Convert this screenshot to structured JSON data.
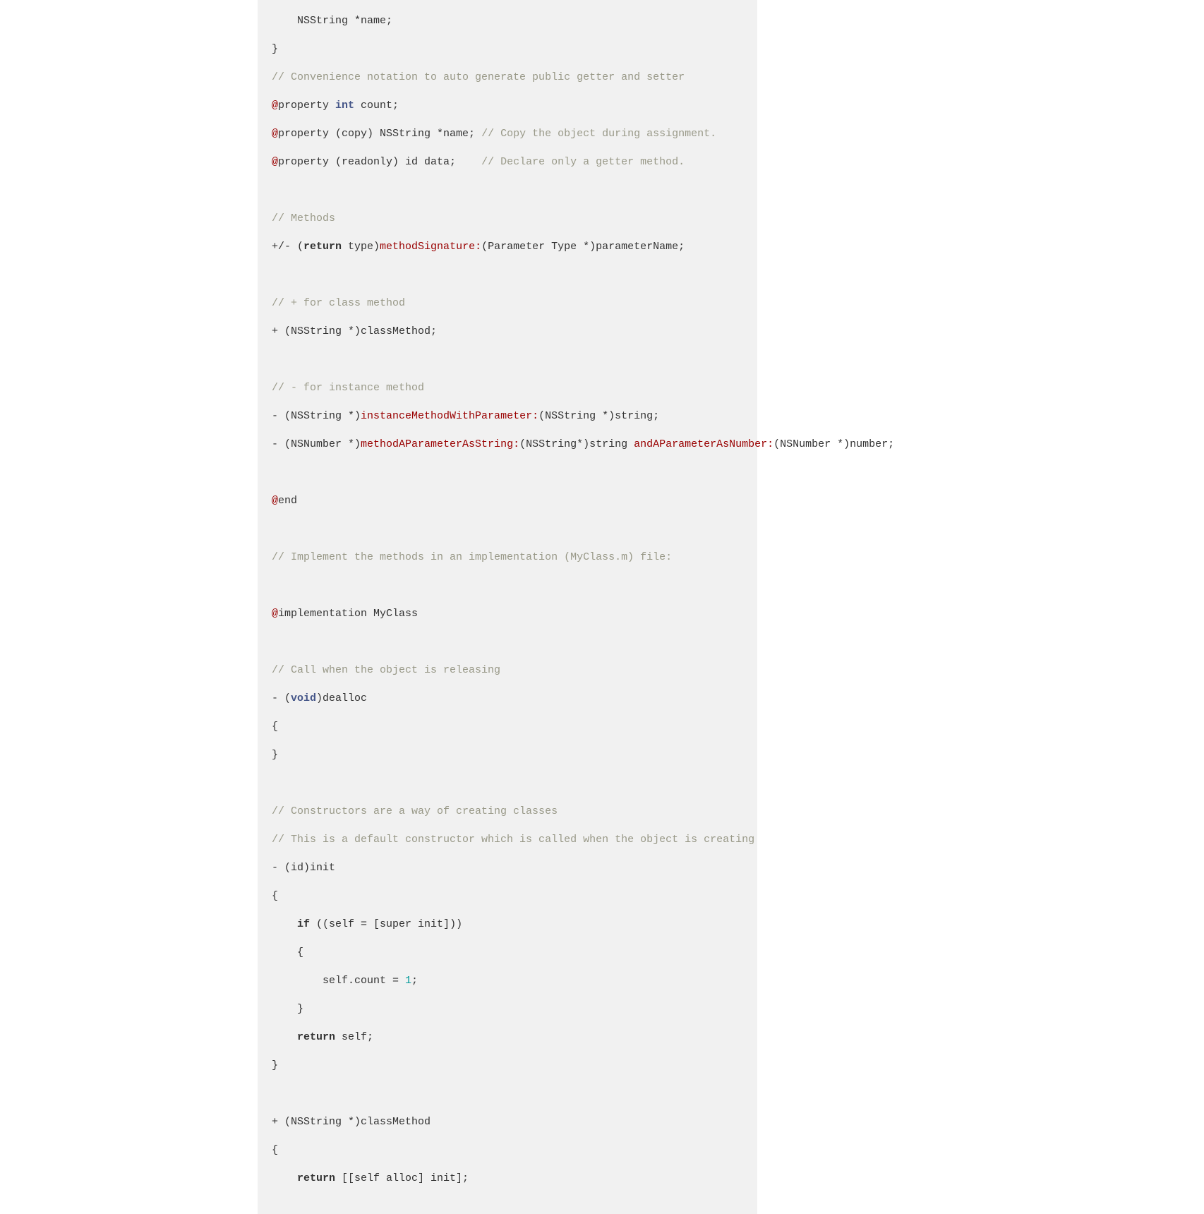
{
  "lines": {
    "l0": "    NSString *name;",
    "l1": "}",
    "c2": "// Convenience notation to auto generate public getter and setter",
    "l3a": "property ",
    "l3b": "int",
    "l3c": " count;",
    "l4a": "property (copy) NSString *name; ",
    "l4b": "// Copy the object during assignment.",
    "l5a": "property (readonly) id data;    ",
    "l5b": "// Declare only a getter method.",
    "c7": "// Methods",
    "l8a": "+/- (",
    "l8b": "return",
    "l8c": " type)",
    "l8d": "methodSignature:",
    "l8e": "(Parameter Type *)parameterName;",
    "c10": "// + for class method",
    "l11": "+ (NSString *)classMethod;",
    "c13": "// - for instance method",
    "l14a": "- (NSString *)",
    "l14b": "instanceMethodWithParameter:",
    "l14c": "(NSString *)string;",
    "l15a": "- (NSNumber *)",
    "l15b": "methodAParameterAsString:",
    "l15c": "(NSString*)string ",
    "l15d": "andAParameterAsNumber:",
    "l15e": "(NSNumber *)number;",
    "l17": "end",
    "c19": "// Implement the methods in an implementation (MyClass.m) file:",
    "l21": "implementation MyClass",
    "c23": "// Call when the object is releasing",
    "l24a": "- (",
    "l24b": "void",
    "l24c": ")dealloc",
    "l25": "{",
    "l26": "}",
    "c28": "// Constructors are a way of creating classes",
    "c29": "// This is a default constructor which is called when the object is creating",
    "l30": "- (id)init",
    "l31": "{",
    "l32a": "    ",
    "l32b": "if",
    "l32c": " ((self = [super init]))",
    "l33": "    {",
    "l34a": "        self.count = ",
    "l34b": "1",
    "l34c": ";",
    "l35": "    }",
    "l36a": "    ",
    "l36b": "return",
    "l36c": " self;",
    "l37": "}",
    "l39": "+ (NSString *)classMethod",
    "l40": "{",
    "l41a": "    ",
    "l41b": "return",
    "l41c": " [[self alloc] init];",
    "at": "@"
  }
}
